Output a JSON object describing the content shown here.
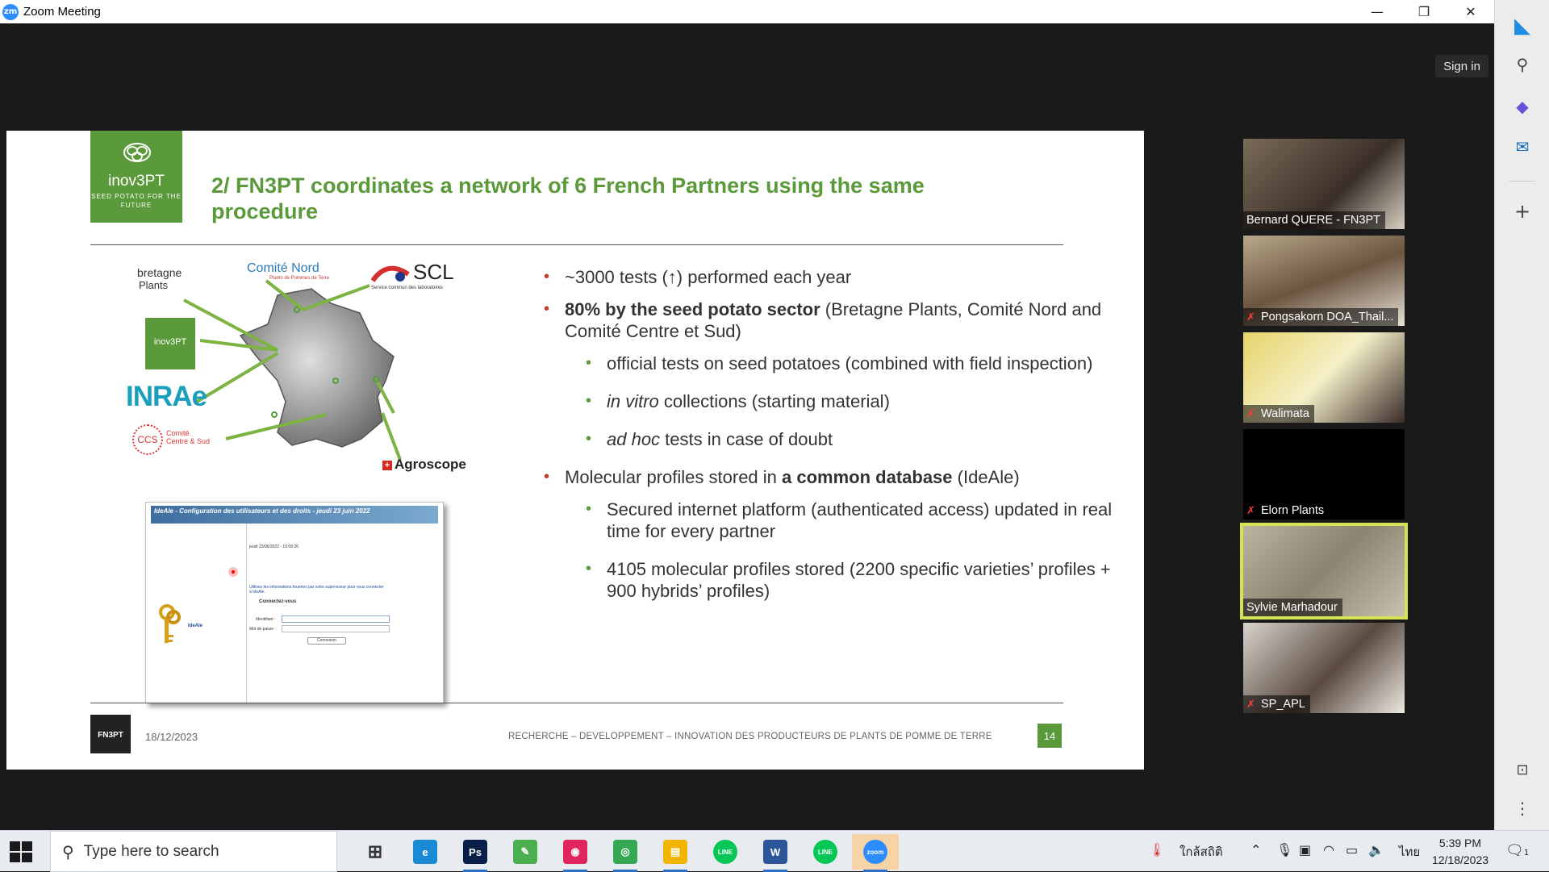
{
  "window": {
    "title": "Zoom Meeting",
    "app_icon": "zm",
    "minimize": "—",
    "restore": "❐",
    "close": "✕"
  },
  "zoom": {
    "sign_in": "Sign in"
  },
  "slide": {
    "logo": {
      "name": "inov3PT",
      "tagline": "SEED POTATO FOR THE FUTURE"
    },
    "title": "2/ FN3PT coordinates a network of 6 French Partners using the same procedure",
    "partners": {
      "bretagne": [
        "bretagne",
        "Plants"
      ],
      "comite_nord": "Comité Nord",
      "comite_nord_sub": "Plants de Pommes de Terre",
      "scl": "SCL",
      "scl_sub": "Service commun des laboratoires",
      "inov_small": "inov3PT",
      "inrae": "INRAe",
      "ccs_mark": "CCS",
      "ccs": [
        "Comité",
        "Centre & Sud"
      ],
      "agroscope": "Agroscope"
    },
    "inset": {
      "header": "IdeAle - Configuration des utilisateurs et des droits - jeudi 23 juin 2022",
      "date": "jeudi 23/06/2022 - 10:09:26",
      "info": "Utilisez les informations fournies par votre superviseur pour vous connecter à IdeAle.",
      "connect": "Connectez-vous",
      "id_label": "Identifiant :",
      "pw_label": "Mot de passe :",
      "button": "Connexion",
      "brand": "IdeAle"
    },
    "bullets": [
      {
        "level": 1,
        "parts": [
          {
            "t": "~3000 tests (↑) performed each year",
            "s": "n"
          }
        ]
      },
      {
        "level": 1,
        "parts": [
          {
            "t": "80% by the seed potato sector",
            "s": "b"
          },
          {
            "t": " (Bretagne Plants, Comité Nord and Comité Centre et Sud)",
            "s": "n"
          }
        ]
      },
      {
        "level": 2,
        "parts": [
          {
            "t": "official tests on seed potatoes (combined with field inspection)",
            "s": "n"
          }
        ]
      },
      {
        "level": 2,
        "parts": [
          {
            "t": "in vitro",
            "s": "i"
          },
          {
            "t": " collections (starting material)",
            "s": "n"
          }
        ]
      },
      {
        "level": 2,
        "parts": [
          {
            "t": "ad hoc",
            "s": "i"
          },
          {
            "t": " tests in case of doubt",
            "s": "n"
          }
        ]
      },
      {
        "level": 1,
        "parts": [
          {
            "t": "Molecular profiles stored in ",
            "s": "n"
          },
          {
            "t": "a common database",
            "s": "b"
          },
          {
            "t": " (IdeAle)",
            "s": "n"
          }
        ]
      },
      {
        "level": 2,
        "parts": [
          {
            "t": "Secured internet platform (authenticated access) updated in real time for every partner",
            "s": "n"
          }
        ]
      },
      {
        "level": 2,
        "parts": [
          {
            "t": "4105 molecular profiles stored  (2200 specific varieties’ profiles + 900 hybrids’ profiles)",
            "s": "n"
          }
        ]
      }
    ],
    "footer": {
      "logo": "FN3PT",
      "date": "18/12/2023",
      "text": "RECHERCHE – DEVELOPPEMENT – INNOVATION DES PRODUCTEURS DE PLANTS DE POMME DE TERRE",
      "page": "14"
    }
  },
  "participants": [
    {
      "name": "Bernard QUERE - FN3PT",
      "muted": false,
      "active": false
    },
    {
      "name": "Pongsakorn DOA_Thail...",
      "muted": true,
      "active": false
    },
    {
      "name": "Walimata",
      "muted": true,
      "active": false
    },
    {
      "name": "Elorn Plants",
      "muted": true,
      "active": false
    },
    {
      "name": "Sylvie Marhadour",
      "muted": false,
      "active": true
    },
    {
      "name": "SP_APL",
      "muted": true,
      "active": false
    }
  ],
  "taskbar": {
    "search_placeholder": "Type here to search",
    "apps": [
      {
        "name": "task-view",
        "label": "⊞",
        "color": "#444"
      },
      {
        "name": "edge",
        "label": "e",
        "color": "#1a8ad4"
      },
      {
        "name": "photoshop",
        "label": "Ps",
        "color": "#0a1e4a"
      },
      {
        "name": "app-green",
        "label": "✎",
        "color": "#4caf50"
      },
      {
        "name": "app-red",
        "label": "◉",
        "color": "#e0245e"
      },
      {
        "name": "chrome",
        "label": "◎",
        "color": "#34a853"
      },
      {
        "name": "file-explorer",
        "label": "▤",
        "color": "#f2b600"
      },
      {
        "name": "line",
        "label": "LINE",
        "color": "#06c755"
      },
      {
        "name": "word",
        "label": "W",
        "color": "#2b579a"
      },
      {
        "name": "line-2",
        "label": "LINE",
        "color": "#06c755"
      },
      {
        "name": "zoom",
        "label": "zoom",
        "color": "#2d8cff"
      }
    ],
    "weather": "ใกล้สถิติ",
    "language": "ไทย",
    "time": "5:39 PM",
    "date": "12/18/2023",
    "notifications": "1"
  }
}
